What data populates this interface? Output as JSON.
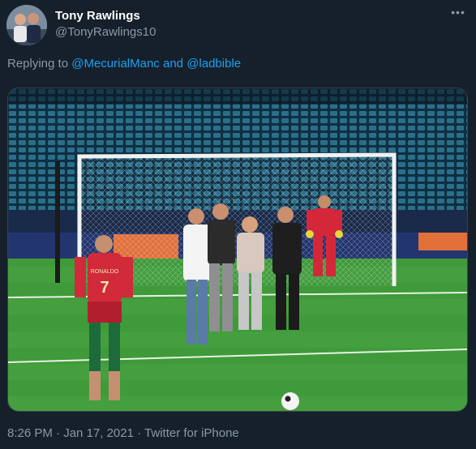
{
  "tweet": {
    "display_name": "Tony Rawlings",
    "handle": "@TonyRawlings10",
    "more_icon": "more-dots-icon",
    "replying_prefix": "Replying to",
    "reply_user_1": "@MecurialManc",
    "reply_connector": "and",
    "reply_user_2": "@ladbible",
    "time": "8:26 PM",
    "date": "Jan 17, 2021",
    "separator": "·",
    "source": "Twitter for iPhone",
    "photo": {
      "jersey_name": "RONALDO",
      "jersey_number": "7"
    }
  },
  "colors": {
    "background": "#15202b",
    "muted": "#8899a6",
    "link": "#1da1f2",
    "pitch": "#3f9a3a"
  }
}
